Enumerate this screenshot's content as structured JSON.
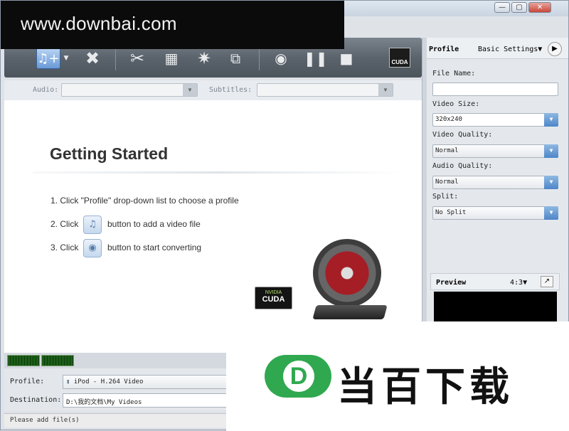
{
  "watermark": "www.downbai.com",
  "window": {
    "min": "—",
    "max": "▢",
    "close": "✕"
  },
  "toolbar": {
    "add_icon": "music-note-plus-icon",
    "delete_icon": "x-icon",
    "cut_icon": "scissors-icon",
    "effect_icon": "film-strip-icon",
    "enhance_icon": "star-icon",
    "merge_icon": "puzzle-icon",
    "record_icon": "record-icon",
    "pause_icon": "pause-icon",
    "stop_icon": "stop-icon",
    "cuda_label": "CUDA"
  },
  "tracks": {
    "audio_label": "Audio:",
    "subtitles_label": "Subtitles:",
    "audio_value": "",
    "subtitles_value": ""
  },
  "getting_started": {
    "title": "Getting Started",
    "step1": "1. Click \"Profile\" drop-down list to choose a profile",
    "step2_a": "2. Click",
    "step2_b": "button to add a video file",
    "step3_a": "3. Click",
    "step3_b": "button to start converting",
    "cuda_badge_top": "NVIDIA",
    "cuda_badge_bottom": "CUDA"
  },
  "sidebar": {
    "profile_tab": "Profile",
    "settings_menu": "Basic Settings",
    "file_name_label": "File Name:",
    "file_name_value": "",
    "video_size_label": "Video Size:",
    "video_size_value": "320x240",
    "video_quality_label": "Video Quality:",
    "video_quality_value": "Normal",
    "audio_quality_label": "Audio Quality:",
    "audio_quality_value": "Normal",
    "split_label": "Split:",
    "split_value": "No Split",
    "preview_label": "Preview",
    "aspect_value": "4:3"
  },
  "bottom": {
    "profile_label": "Profile:",
    "profile_value": "iPod - H.264 Video",
    "destination_label": "Destination:",
    "destination_value": "D:\\我的文档\\My Videos"
  },
  "status": "Please add file(s)",
  "logo": {
    "mark_letter": "D",
    "text": "当百下载",
    "color": "#2fa84f"
  }
}
